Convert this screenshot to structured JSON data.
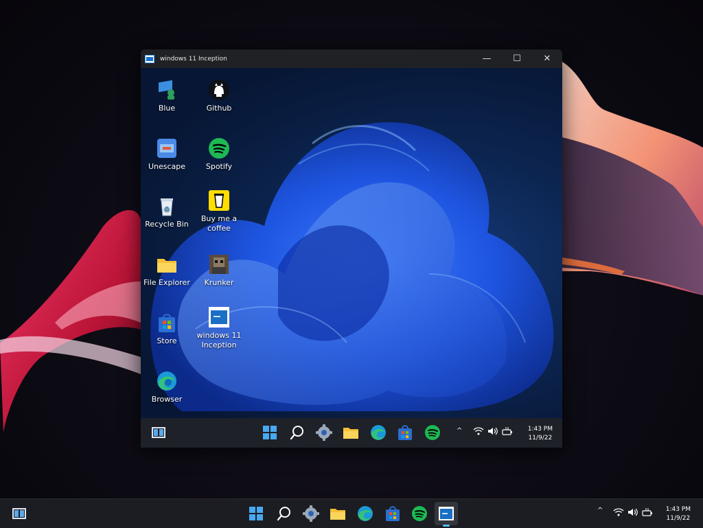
{
  "vm_window": {
    "title": "windows 11 Inception",
    "controls": {
      "minimize": "—",
      "maximize": "☐",
      "close": "✕"
    }
  },
  "desktop_icons": [
    {
      "label": "Blue",
      "icon": "blue-remote-desktop-icon"
    },
    {
      "label": "Github",
      "icon": "github-icon"
    },
    {
      "label": "Unescape",
      "icon": "unescape-icon"
    },
    {
      "label": "Spotify",
      "icon": "spotify-icon"
    },
    {
      "label": "Recycle Bin",
      "icon": "recycle-bin-icon"
    },
    {
      "label": "Buy me a coffee",
      "icon": "coffee-icon"
    },
    {
      "label": "File Explorer",
      "icon": "folder-icon"
    },
    {
      "label": "Krunker",
      "icon": "krunker-icon"
    },
    {
      "label": "Store",
      "icon": "store-icon"
    },
    {
      "label": "windows 11 Inception",
      "icon": "inception-icon"
    },
    {
      "label": "Browser",
      "icon": "edge-icon"
    }
  ],
  "inner_taskbar": {
    "time": "1:43 PM",
    "date": "11/9/22",
    "tray": {
      "chevron": "^",
      "wifi": "wifi-icon",
      "volume": "volume-icon",
      "battery": "battery-icon"
    }
  },
  "outer_taskbar": {
    "time": "1:43 PM",
    "date": "11/9/22"
  },
  "colors": {
    "accent": "#4cc2ff",
    "taskbar": "#1c1d22",
    "spotify": "#1db954",
    "folder": "#f5c037"
  }
}
